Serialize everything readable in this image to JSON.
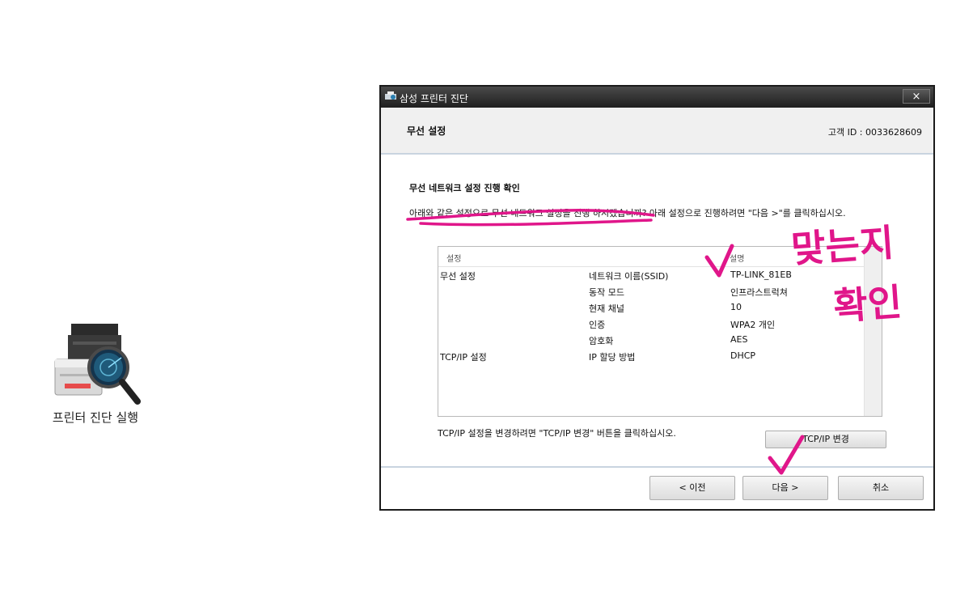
{
  "desktop": {
    "shortcut_label": "프린터 진단 실행"
  },
  "window": {
    "title": "삼성 프린터 진단",
    "close_symbol": "×",
    "section_title": "무선 설정",
    "customer_id": "고객 ID : 0033628609"
  },
  "content": {
    "heading": "무선 네트워크 설정 진행 확인",
    "instruction": "아래와 같은 설정으로 무선 네트워크 설정을 진행 하시겠습니까? 아래 설정으로 진행하려면 \"다음 >\"를 클릭하십시오.",
    "table": {
      "headers": [
        "설정",
        "설명"
      ],
      "rows": [
        {
          "category": "무선 설정",
          "item": "네트워크 이름(SSID)",
          "value": "TP-LINK_81EB"
        },
        {
          "category": "",
          "item": "동작 모드",
          "value": "인프라스트럭쳐"
        },
        {
          "category": "",
          "item": "현재 채널",
          "value": "10"
        },
        {
          "category": "",
          "item": "인증",
          "value": "WPA2 개인"
        },
        {
          "category": "",
          "item": "암호화",
          "value": "AES"
        },
        {
          "category": "TCP/IP 설정",
          "item": "IP 할당 방법",
          "value": "DHCP"
        }
      ]
    },
    "tcp_note": "TCP/IP 설정을 변경하려면 \"TCP/IP 변경\" 버튼을 클릭하십시오.",
    "tcp_button": "TCP/IP 변경"
  },
  "footer": {
    "prev_button": "< 이전",
    "next_button": "다음 >",
    "cancel_button": "취소"
  },
  "annotations": {
    "handwriting_line1": "맞는지",
    "handwriting_line2": "확인",
    "color": "#e0168a"
  }
}
